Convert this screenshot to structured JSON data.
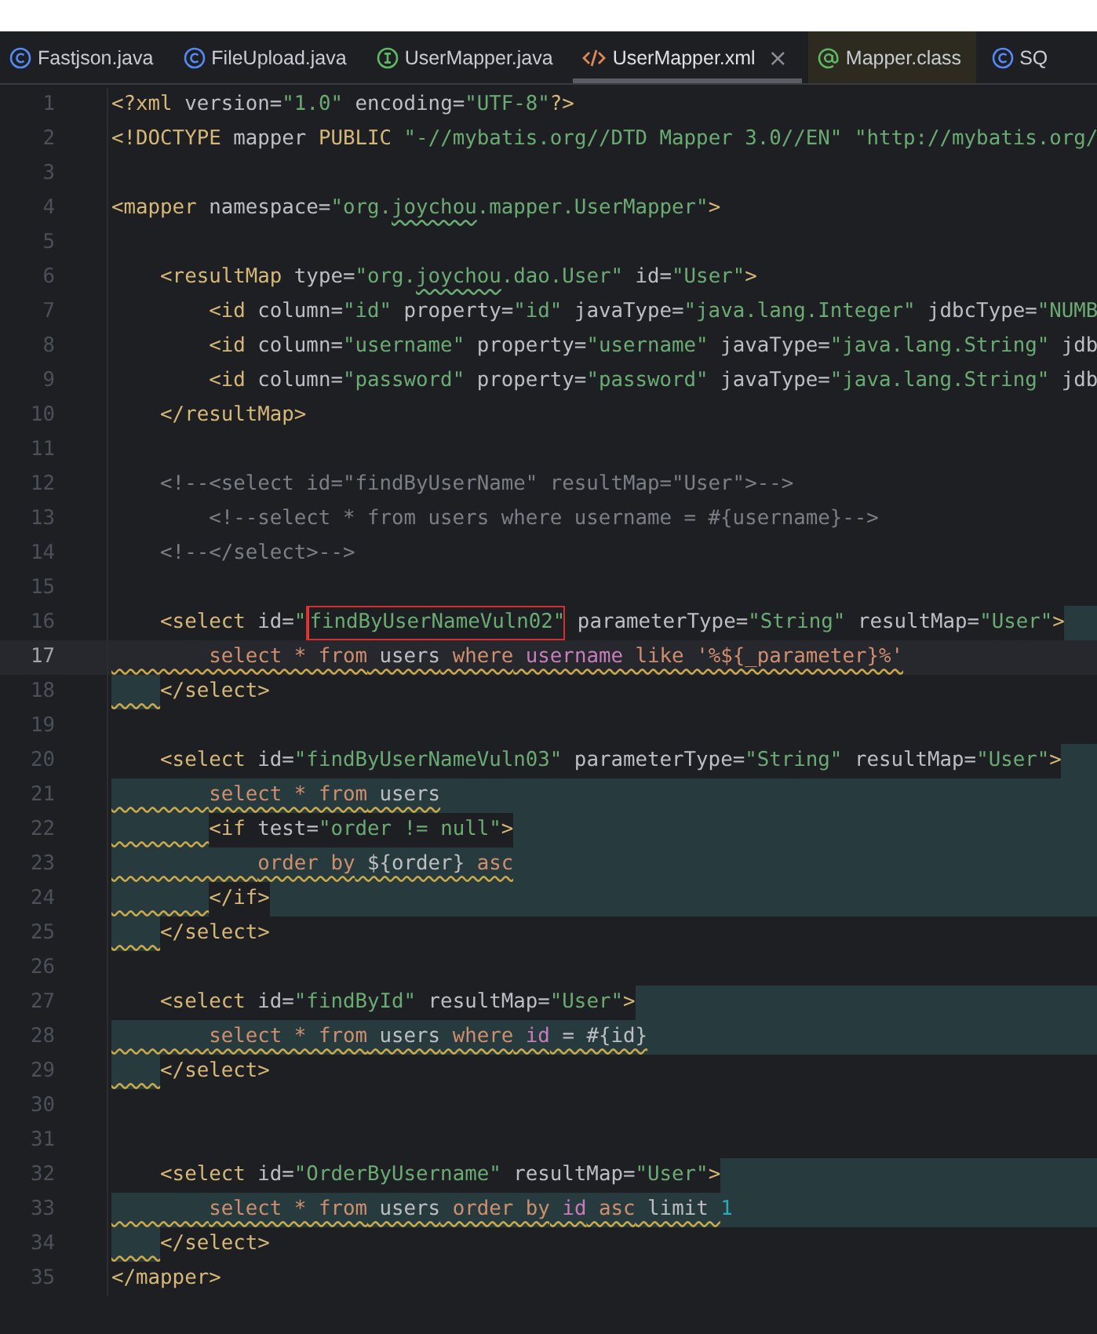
{
  "tabs": [
    {
      "label": "Fastjson.java",
      "kind": "class",
      "selected": false,
      "library": false
    },
    {
      "label": "FileUpload.java",
      "kind": "class",
      "selected": false,
      "library": false
    },
    {
      "label": "UserMapper.java",
      "kind": "interface",
      "selected": false,
      "library": false
    },
    {
      "label": "UserMapper.xml",
      "kind": "xml",
      "selected": true,
      "library": false,
      "close": "×"
    },
    {
      "label": "Mapper.class",
      "kind": "annotation",
      "selected": false,
      "library": true
    },
    {
      "label": "SQ",
      "kind": "class",
      "selected": false,
      "library": false
    }
  ],
  "lines": [
    {
      "number": "1",
      "current": false,
      "tokens": [
        {
          "text": "<?xml",
          "kind": "tag"
        },
        {
          "text": " version=",
          "kind": "attr"
        },
        {
          "text": "\"1.0\"",
          "kind": "str"
        },
        {
          "text": " encoding=",
          "kind": "attr"
        },
        {
          "text": "\"UTF-8\"",
          "kind": "str"
        },
        {
          "text": "?>",
          "kind": "tag"
        }
      ]
    },
    {
      "number": "2",
      "current": false,
      "tokens": [
        {
          "text": "<!DOCTYPE",
          "kind": "tag"
        },
        {
          "text": " mapper ",
          "kind": "attr"
        },
        {
          "text": "PUBLIC",
          "kind": "tag"
        },
        {
          "text": " \"-//mybatis.org//DTD Mapper 3.0//EN\"",
          "kind": "str"
        },
        {
          "text": " \"http://mybatis.org/",
          "kind": "str"
        }
      ]
    },
    {
      "number": "3",
      "current": false
    },
    {
      "number": "4",
      "current": false,
      "tokens": [
        {
          "text": "<mapper",
          "kind": "tag"
        },
        {
          "text": " namespace=",
          "kind": "attr"
        },
        {
          "text": "\"org.",
          "kind": "str"
        },
        {
          "text": "joychou",
          "kind": "str",
          "typo": true
        },
        {
          "text": ".mapper.UserMapper\"",
          "kind": "str"
        },
        {
          "text": ">",
          "kind": "tag"
        }
      ]
    },
    {
      "number": "5",
      "current": false
    },
    {
      "number": "6",
      "current": false,
      "tokens": [
        {
          "text": "    <resultMap",
          "kind": "tag"
        },
        {
          "text": " type=",
          "kind": "attr"
        },
        {
          "text": "\"org.",
          "kind": "str"
        },
        {
          "text": "joychou",
          "kind": "str",
          "typo": true
        },
        {
          "text": ".dao.User\"",
          "kind": "str"
        },
        {
          "text": " id=",
          "kind": "attr"
        },
        {
          "text": "\"User\"",
          "kind": "str"
        },
        {
          "text": ">",
          "kind": "tag"
        }
      ]
    },
    {
      "number": "7",
      "current": false,
      "tokens": [
        {
          "text": "        <id",
          "kind": "tag"
        },
        {
          "text": " column=",
          "kind": "attr"
        },
        {
          "text": "\"id\"",
          "kind": "str"
        },
        {
          "text": " property=",
          "kind": "attr"
        },
        {
          "text": "\"id\"",
          "kind": "str"
        },
        {
          "text": " javaType=",
          "kind": "attr"
        },
        {
          "text": "\"java.lang.Integer\"",
          "kind": "str"
        },
        {
          "text": " jdbcType=",
          "kind": "attr"
        },
        {
          "text": "\"NUMB",
          "kind": "str"
        }
      ]
    },
    {
      "number": "8",
      "current": false,
      "tokens": [
        {
          "text": "        <id",
          "kind": "tag"
        },
        {
          "text": " column=",
          "kind": "attr"
        },
        {
          "text": "\"username\"",
          "kind": "str"
        },
        {
          "text": " property=",
          "kind": "attr"
        },
        {
          "text": "\"username\"",
          "kind": "str"
        },
        {
          "text": " javaType=",
          "kind": "attr"
        },
        {
          "text": "\"java.lang.String\"",
          "kind": "str"
        },
        {
          "text": " jdb",
          "kind": "attr"
        }
      ]
    },
    {
      "number": "9",
      "current": false,
      "tokens": [
        {
          "text": "        <id",
          "kind": "tag"
        },
        {
          "text": " column=",
          "kind": "attr"
        },
        {
          "text": "\"password\"",
          "kind": "str"
        },
        {
          "text": " property=",
          "kind": "attr"
        },
        {
          "text": "\"password\"",
          "kind": "str"
        },
        {
          "text": " javaType=",
          "kind": "attr"
        },
        {
          "text": "\"java.lang.String\"",
          "kind": "str"
        },
        {
          "text": " jdb",
          "kind": "attr"
        }
      ]
    },
    {
      "number": "10",
      "current": false,
      "tokens": [
        {
          "text": "    </resultMap>",
          "kind": "tag"
        }
      ]
    },
    {
      "number": "11",
      "current": false
    },
    {
      "number": "12",
      "current": false,
      "tokens": [
        {
          "text": "    <!--<select id=\"findByUserName\" resultMap=\"User\">-->",
          "kind": "comment"
        }
      ]
    },
    {
      "number": "13",
      "current": false,
      "tokens": [
        {
          "text": "        <!--select * from users where username = #{username}-->",
          "kind": "comment"
        }
      ]
    },
    {
      "number": "14",
      "current": false,
      "tokens": [
        {
          "text": "    <!--</select>-->",
          "kind": "comment"
        }
      ]
    },
    {
      "number": "15",
      "current": false
    },
    {
      "number": "16",
      "current": false,
      "tail": true,
      "tokens": [
        {
          "text": "    <select",
          "kind": "tag"
        },
        {
          "text": " id=",
          "kind": "attr"
        },
        {
          "text": "\"",
          "kind": "str"
        },
        {
          "text": "findByUserNameVuln02\"",
          "kind": "str",
          "boxed": true
        },
        {
          "text": " parameterType=",
          "kind": "attr"
        },
        {
          "text": "\"String\"",
          "kind": "str"
        },
        {
          "text": " resultMap=",
          "kind": "attr"
        },
        {
          "text": "\"User\"",
          "kind": "str"
        },
        {
          "text": ">",
          "kind": "tag"
        }
      ]
    },
    {
      "number": "17",
      "current": true,
      "tokens": [
        {
          "text": "        select * from",
          "kind": "kw",
          "wavy": true
        },
        {
          "text": " users",
          "kind": "attr",
          "wavy": true
        },
        {
          "text": " where",
          "kind": "kw",
          "wavy": true
        },
        {
          "text": " username",
          "kind": "field",
          "wavy": true
        },
        {
          "text": " like '%${_parameter}%'",
          "kind": "kw",
          "wavy": true
        }
      ]
    },
    {
      "number": "18",
      "current": false,
      "shaded_indent": true,
      "tokens": [
        {
          "text": "    </select>",
          "kind": "tag"
        }
      ]
    },
    {
      "number": "19",
      "current": false
    },
    {
      "number": "20",
      "current": false,
      "tail": true,
      "tokens": [
        {
          "text": "    <select",
          "kind": "tag"
        },
        {
          "text": " id=",
          "kind": "attr"
        },
        {
          "text": "\"findByUserNameVuln03\"",
          "kind": "str"
        },
        {
          "text": " parameterType=",
          "kind": "attr"
        },
        {
          "text": "\"String\"",
          "kind": "str"
        },
        {
          "text": " resultMap=",
          "kind": "attr"
        },
        {
          "text": "\"User\"",
          "kind": "str"
        },
        {
          "text": ">",
          "kind": "tag"
        }
      ]
    },
    {
      "number": "21",
      "current": false,
      "tail": true,
      "shaded_indent": true,
      "tokens": [
        {
          "text": "        select * from",
          "kind": "kw",
          "wavy": true,
          "shaded": true
        },
        {
          "text": " users",
          "kind": "attr",
          "wavy": true,
          "shaded": true
        }
      ]
    },
    {
      "number": "22",
      "current": false,
      "tail": true,
      "shaded_indent": true,
      "tokens": [
        {
          "text": "        <if",
          "kind": "tag"
        },
        {
          "text": " test=",
          "kind": "attr"
        },
        {
          "text": "\"order != null\"",
          "kind": "str"
        },
        {
          "text": ">",
          "kind": "tag"
        }
      ]
    },
    {
      "number": "23",
      "current": false,
      "tail": true,
      "shaded_indent": true,
      "tokens": [
        {
          "text": "            order by",
          "kind": "kw",
          "wavy": true,
          "shaded": true
        },
        {
          "text": " ${order}",
          "kind": "attr",
          "wavy": true,
          "shaded": true
        },
        {
          "text": " asc",
          "kind": "kw",
          "wavy": true,
          "shaded": true
        }
      ]
    },
    {
      "number": "24",
      "current": false,
      "tail": true,
      "shaded_indent": true,
      "tokens": [
        {
          "text": "        </if>",
          "kind": "tag"
        }
      ]
    },
    {
      "number": "25",
      "current": false,
      "shaded_indent": true,
      "tokens": [
        {
          "text": "    </select>",
          "kind": "tag"
        }
      ]
    },
    {
      "number": "26",
      "current": false
    },
    {
      "number": "27",
      "current": false,
      "tail": true,
      "tokens": [
        {
          "text": "    <select",
          "kind": "tag"
        },
        {
          "text": " id=",
          "kind": "attr"
        },
        {
          "text": "\"findById\"",
          "kind": "str"
        },
        {
          "text": " resultMap=",
          "kind": "attr"
        },
        {
          "text": "\"User\"",
          "kind": "str"
        },
        {
          "text": ">",
          "kind": "tag"
        }
      ]
    },
    {
      "number": "28",
      "current": false,
      "tail": true,
      "shaded_indent": true,
      "tokens": [
        {
          "text": "        select * from",
          "kind": "kw",
          "wavy": true,
          "shaded": true
        },
        {
          "text": " users",
          "kind": "attr",
          "wavy": true,
          "shaded": true
        },
        {
          "text": " where",
          "kind": "kw",
          "wavy": true,
          "shaded": true
        },
        {
          "text": " id",
          "kind": "field",
          "wavy": true,
          "shaded": true
        },
        {
          "text": " = #{id}",
          "kind": "attr",
          "wavy": true,
          "shaded": true
        }
      ]
    },
    {
      "number": "29",
      "current": false,
      "shaded_indent": true,
      "tokens": [
        {
          "text": "    </select>",
          "kind": "tag"
        }
      ]
    },
    {
      "number": "30",
      "current": false
    },
    {
      "number": "31",
      "current": false
    },
    {
      "number": "32",
      "current": false,
      "tail": true,
      "tokens": [
        {
          "text": "    <select",
          "kind": "tag"
        },
        {
          "text": " id=",
          "kind": "attr"
        },
        {
          "text": "\"OrderByUsername\"",
          "kind": "str"
        },
        {
          "text": " resultMap=",
          "kind": "attr"
        },
        {
          "text": "\"User\"",
          "kind": "str"
        },
        {
          "text": ">",
          "kind": "tag"
        }
      ]
    },
    {
      "number": "33",
      "current": false,
      "tail": true,
      "shaded_indent": true,
      "tokens": [
        {
          "text": "        select * from",
          "kind": "kw",
          "wavy": true,
          "shaded": true
        },
        {
          "text": " users",
          "kind": "attr",
          "wavy": true,
          "shaded": true
        },
        {
          "text": " order by",
          "kind": "kw",
          "wavy": true,
          "shaded": true
        },
        {
          "text": " id",
          "kind": "field",
          "wavy": true,
          "shaded": true
        },
        {
          "text": " asc",
          "kind": "kw",
          "wavy": true,
          "shaded": true
        },
        {
          "text": " limit ",
          "kind": "attr",
          "wavy": true,
          "shaded": true
        },
        {
          "text": "1",
          "kind": "num",
          "shaded": true
        }
      ]
    },
    {
      "number": "34",
      "current": false,
      "shaded_indent": true,
      "tokens": [
        {
          "text": "    </select>",
          "kind": "tag"
        }
      ]
    },
    {
      "number": "35",
      "current": false,
      "tokens": [
        {
          "text": "</mapper>",
          "kind": "tag"
        }
      ]
    }
  ]
}
